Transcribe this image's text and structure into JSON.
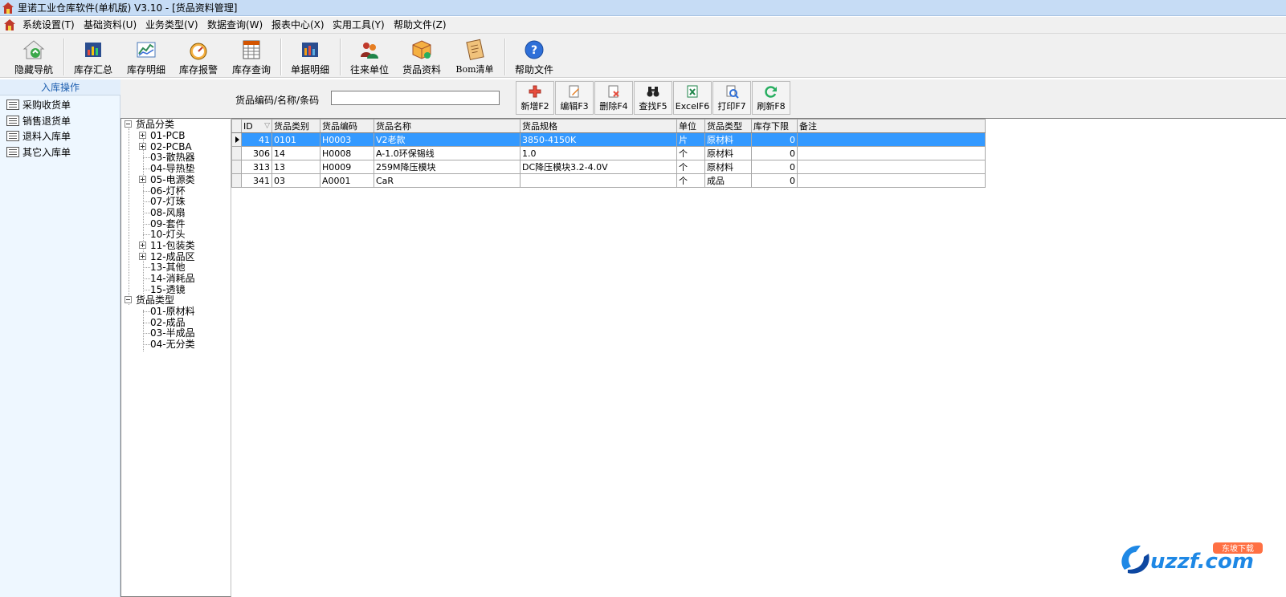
{
  "window": {
    "title": "里诺工业仓库软件(单机版) V3.10 - [货品资料管理]"
  },
  "menu": [
    {
      "label": "系统设置(T)"
    },
    {
      "label": "基础资料(U)"
    },
    {
      "label": "业务类型(V)"
    },
    {
      "label": "数据查询(W)"
    },
    {
      "label": "报表中心(X)"
    },
    {
      "label": "实用工具(Y)"
    },
    {
      "label": "帮助文件(Z)"
    }
  ],
  "toolbar": [
    {
      "label": "隐藏导航",
      "icon": "house-icon"
    },
    {
      "label": "库存汇总",
      "icon": "bar-chart-icon"
    },
    {
      "label": "库存明细",
      "icon": "line-chart-icon"
    },
    {
      "label": "库存报警",
      "icon": "gauge-icon"
    },
    {
      "label": "库存查询",
      "icon": "spreadsheet-icon"
    },
    {
      "label": "单据明细",
      "icon": "bar-chart-icon"
    },
    {
      "label": "往来单位",
      "icon": "users-icon"
    },
    {
      "label": "货品资料",
      "icon": "box-icon"
    },
    {
      "label": "Bom清单",
      "icon": "notebook-icon"
    },
    {
      "label": "帮助文件",
      "icon": "help-icon"
    }
  ],
  "leftnav": {
    "header": "入库操作",
    "items": [
      {
        "label": "采购收货单"
      },
      {
        "label": "销售退货单"
      },
      {
        "label": "退料入库单"
      },
      {
        "label": "其它入库单"
      }
    ]
  },
  "search": {
    "label": "货品编码/名称/条码",
    "value": ""
  },
  "actions": [
    {
      "label": "新增F2",
      "icon": "add-icon"
    },
    {
      "label": "编辑F3",
      "icon": "edit-icon"
    },
    {
      "label": "删除F4",
      "icon": "delete-icon"
    },
    {
      "label": "查找F5",
      "icon": "binoculars-icon"
    },
    {
      "label": "ExcelF6",
      "icon": "excel-icon"
    },
    {
      "label": "打印F7",
      "icon": "print-icon"
    },
    {
      "label": "刷新F8",
      "icon": "refresh-icon"
    }
  ],
  "tree": {
    "root1": "货品分类",
    "categories": [
      {
        "label": "01-PCB",
        "expandable": true
      },
      {
        "label": "02-PCBA",
        "expandable": true
      },
      {
        "label": "03-散热器",
        "expandable": false
      },
      {
        "label": "04-导热垫",
        "expandable": false
      },
      {
        "label": "05-电源类",
        "expandable": true
      },
      {
        "label": "06-灯杯",
        "expandable": false
      },
      {
        "label": "07-灯珠",
        "expandable": false
      },
      {
        "label": "08-风扇",
        "expandable": false
      },
      {
        "label": "09-套件",
        "expandable": false
      },
      {
        "label": "10-灯头",
        "expandable": false
      },
      {
        "label": "11-包装类",
        "expandable": true
      },
      {
        "label": "12-成品区",
        "expandable": true
      },
      {
        "label": "13-其他",
        "expandable": false
      },
      {
        "label": "14-消耗品",
        "expandable": false
      },
      {
        "label": "15-透镜",
        "expandable": false
      }
    ],
    "root2": "货品类型",
    "types": [
      {
        "label": "01-原材料"
      },
      {
        "label": "02-成品"
      },
      {
        "label": "03-半成品"
      },
      {
        "label": "04-无分类"
      }
    ]
  },
  "grid": {
    "sort_icon": "sort-desc-icon",
    "columns": [
      "ID",
      "货品类别",
      "货品编码",
      "货品名称",
      "货品规格",
      "单位",
      "货品类型",
      "库存下限",
      "备注"
    ],
    "rows": [
      {
        "id": "41",
        "category": "0101",
        "code": "H0003",
        "name": "V2老款",
        "spec": "3850-4150K",
        "unit": "片",
        "type": "原材料",
        "min_stock": "0",
        "note": "",
        "selected": true
      },
      {
        "id": "306",
        "category": "14",
        "code": "H0008",
        "name": "A-1.0环保锡线",
        "spec": "1.0",
        "unit": "个",
        "type": "原材料",
        "min_stock": "0",
        "note": "",
        "selected": false
      },
      {
        "id": "313",
        "category": "13",
        "code": "H0009",
        "name": "259M降压模块",
        "spec": "DC降压模块3.2-4.0V",
        "unit": "个",
        "type": "原材料",
        "min_stock": "0",
        "note": "",
        "selected": false
      },
      {
        "id": "341",
        "category": "03",
        "code": "A0001",
        "name": "CaR",
        "spec": "",
        "unit": "个",
        "type": "成品",
        "min_stock": "0",
        "note": "",
        "selected": false
      }
    ]
  },
  "watermark": {
    "text_main": "uzzf.com",
    "text_badge": "东坡下载"
  },
  "colors": {
    "selection": "#3399ff",
    "titlebar": "#c6dcf5",
    "nav_bg": "#eef7ff",
    "accent": "#1e5fb0"
  }
}
